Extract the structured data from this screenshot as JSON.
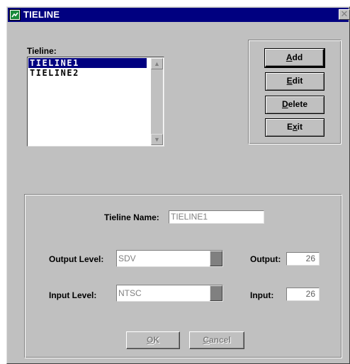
{
  "window": {
    "title": "TIELINE",
    "close_glyph": "✕"
  },
  "tieline_list": {
    "label": "Tieline:",
    "items": [
      {
        "label": "TIELINE1",
        "selected": true
      },
      {
        "label": "TIELINE2",
        "selected": false
      }
    ]
  },
  "actions": {
    "add": {
      "accel": "A",
      "rest": "dd"
    },
    "edit": {
      "accel": "E",
      "rest": "dit"
    },
    "delete": {
      "accel": "D",
      "rest": "elete"
    },
    "exit": {
      "pre": "E",
      "accel": "x",
      "rest": "it"
    }
  },
  "properties": {
    "tieline_name_label": "Tieline Name:",
    "tieline_name_value": "TIELINE1",
    "output_level_label": "Output Level:",
    "output_level_value": "SDV",
    "output_label": "Output:",
    "output_value": "26",
    "input_level_label": "Input Level:",
    "input_level_value": "NTSC",
    "input_label": "Input:",
    "input_value": "26"
  },
  "dialog_buttons": {
    "ok": {
      "accel": "O",
      "rest": "K"
    },
    "cancel": {
      "accel": "C",
      "rest": "ancel"
    }
  },
  "colors": {
    "titlebar": "#000080",
    "face": "#c0c0c0",
    "selection": "#000080"
  },
  "icons": {
    "app": "app-icon",
    "close": "close-icon",
    "scroll_up": "scroll-up-arrow-icon",
    "scroll_down": "scroll-down-arrow-icon"
  }
}
